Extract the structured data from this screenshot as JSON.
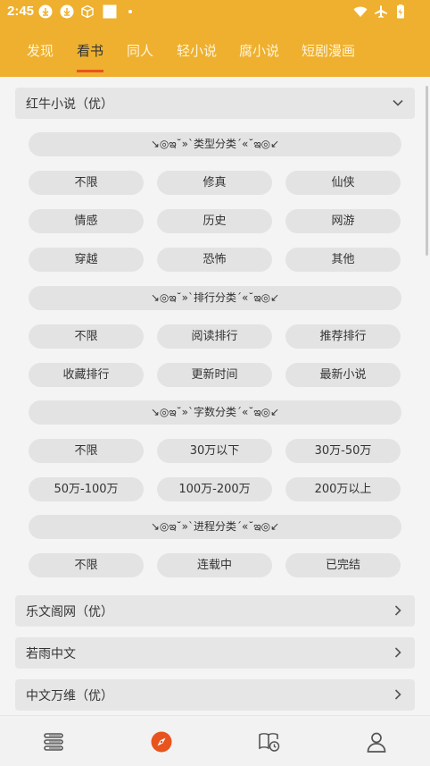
{
  "status": {
    "time": "2:45"
  },
  "tabs": [
    {
      "label": "发现"
    },
    {
      "label": "看书"
    },
    {
      "label": "同人"
    },
    {
      "label": "轻小说"
    },
    {
      "label": "腐小说"
    },
    {
      "label": "短剧漫画"
    }
  ],
  "active_tab": "看书",
  "expanded_source": {
    "title": "红牛小说（优）",
    "categories": [
      {
        "label": "↘◎ఇ˘»`类型分类´«˘ఇ◎↙",
        "options": [
          "不限",
          "修真",
          "仙侠",
          "情感",
          "历史",
          "网游",
          "穿越",
          "恐怖",
          "其他"
        ]
      },
      {
        "label": "↘◎ఇ˘»`排行分类´«˘ఇ◎↙",
        "options": [
          "不限",
          "阅读排行",
          "推荐排行",
          "收藏排行",
          "更新时间",
          "最新小说"
        ]
      },
      {
        "label": "↘◎ఇ˘»`字数分类´«˘ఇ◎↙",
        "options": [
          "不限",
          "30万以下",
          "30万-50万",
          "50万-100万",
          "100万-200万",
          "200万以上"
        ]
      },
      {
        "label": "↘◎ఇ˘»`进程分类´«˘ఇ◎↙",
        "options": [
          "不限",
          "连载中",
          "已完结"
        ]
      }
    ]
  },
  "collapsed_sources": [
    {
      "title": "乐文阁网（优）"
    },
    {
      "title": "若雨中文"
    },
    {
      "title": "中文万维（优）"
    }
  ],
  "icons": {
    "status": [
      "download-icon",
      "download-icon",
      "cube-icon",
      "square-icon",
      "dot-icon",
      "wifi-icon",
      "airplane-icon",
      "battery-icon"
    ],
    "nav": [
      "bookshelf-icon",
      "compass-icon",
      "subscription-icon",
      "profile-icon"
    ]
  },
  "colors": {
    "accent": "#eeb02e",
    "active": "#e8541e"
  }
}
